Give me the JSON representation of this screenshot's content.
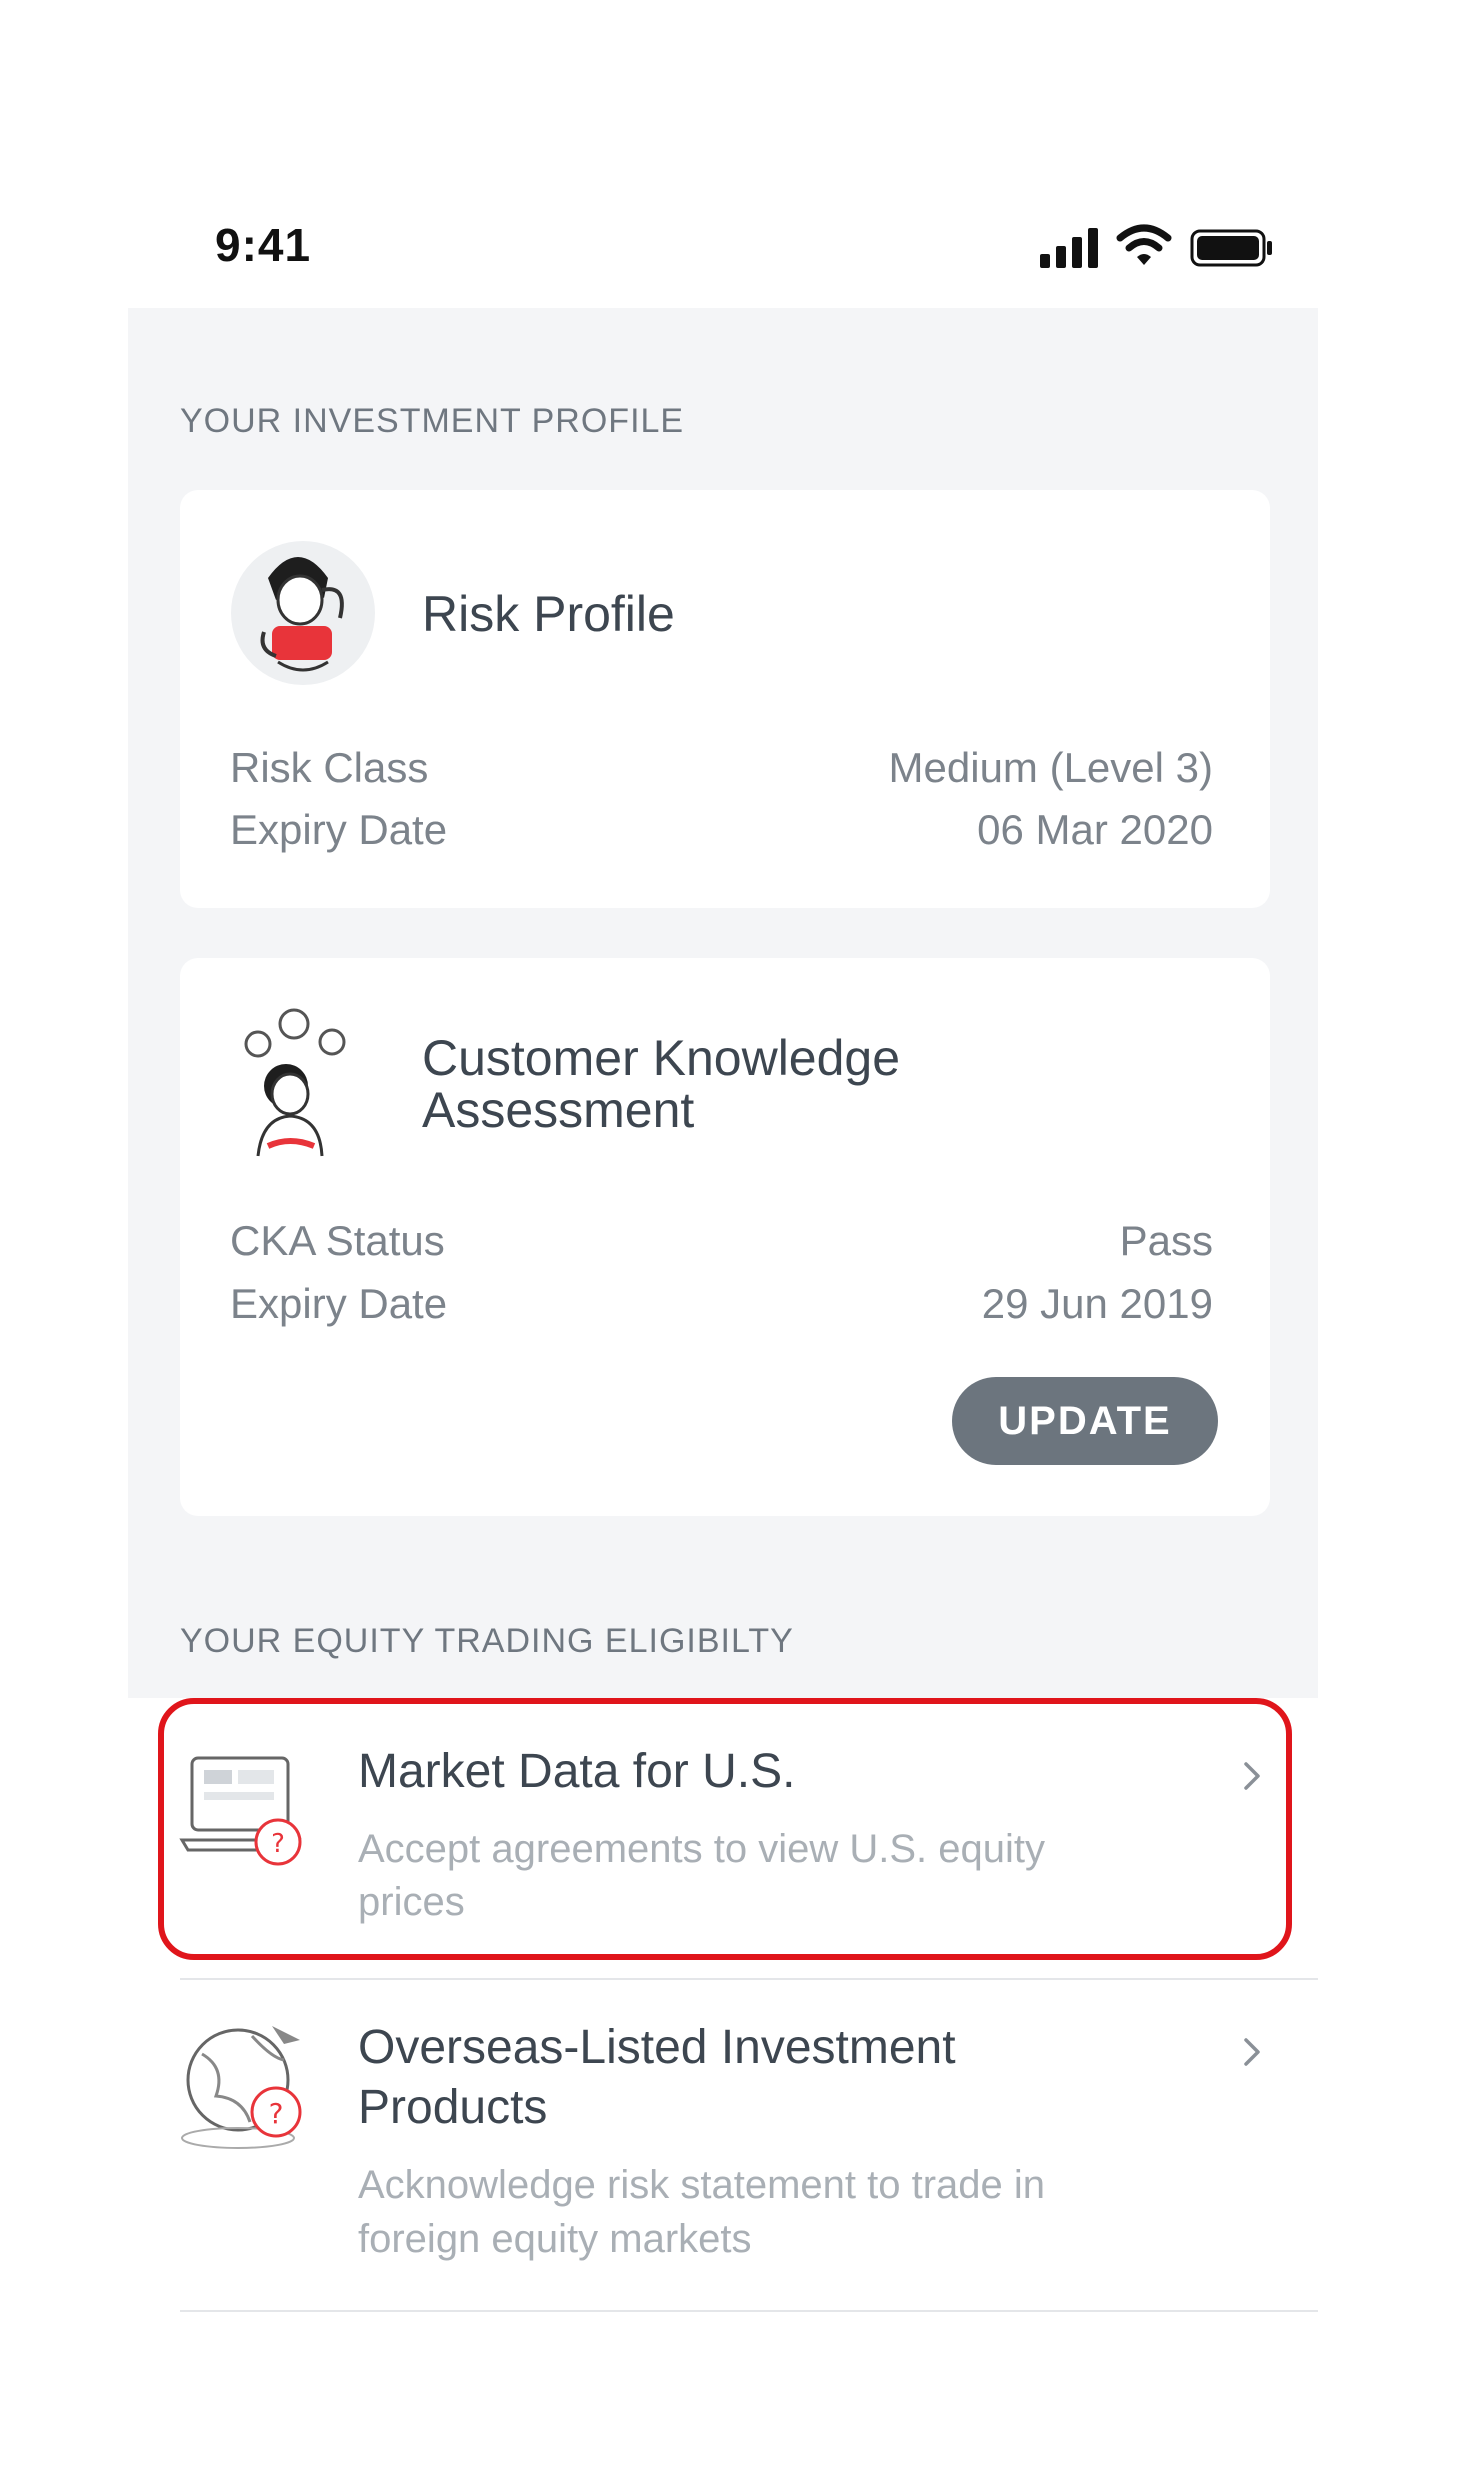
{
  "status_bar": {
    "time": "9:41",
    "icons": [
      "cellular-signal-icon",
      "wifi-icon",
      "battery-icon"
    ]
  },
  "investment_profile": {
    "section_title": "YOUR INVESTMENT PROFILE",
    "risk_profile": {
      "heading": "Risk Profile",
      "illustration": "thinking-woman-illustration",
      "rows": [
        {
          "label": "Risk Class",
          "value": "Medium (Level 3)"
        },
        {
          "label": "Expiry Date",
          "value": "06 Mar 2020"
        }
      ]
    },
    "cka": {
      "heading_line1": "Customer Knowledge",
      "heading_line2": "Assessment",
      "illustration": "thinking-person-illustration",
      "rows": [
        {
          "label": "CKA Status",
          "value": "Pass"
        },
        {
          "label": "Expiry Date",
          "value": "29 Jun 2019"
        }
      ],
      "update_label": "UPDATE"
    }
  },
  "equity_eligibility": {
    "section_title": "YOUR EQUITY TRADING ELIGIBILTY",
    "items": [
      {
        "title": "Market Data for U.S.",
        "subtitle_line1": "Accept agreements to view U.S. equity",
        "subtitle_line2": "prices",
        "icon": "market-data-laptop-icon",
        "highlighted": true
      },
      {
        "title_line1": "Overseas-Listed Investment",
        "title_line2": "Products",
        "subtitle_line1": "Acknowledge risk statement to trade in",
        "subtitle_line2": "foreign equity markets",
        "icon": "overseas-globe-icon",
        "highlighted": false
      }
    ]
  },
  "colors": {
    "panel_bg": "#f4f5f7",
    "button_bg": "#6c757e",
    "highlight": "#e0151b",
    "accent_red": "#e8343a"
  }
}
